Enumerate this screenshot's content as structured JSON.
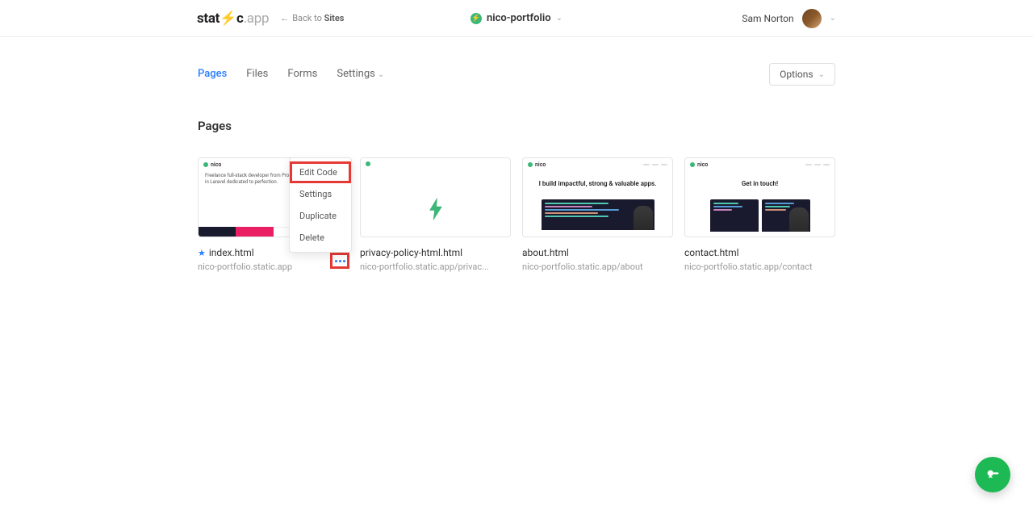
{
  "header": {
    "logo_prefix": "stat",
    "logo_bolt": "i",
    "logo_suffix": "c",
    "logo_ext": ".app",
    "back_arrow": "←",
    "back_text": "Back to ",
    "back_target": "Sites",
    "site_name": "nico-portfolio",
    "user_name": "Sam Norton"
  },
  "tabs": {
    "pages": "Pages",
    "files": "Files",
    "forms": "Forms",
    "settings": "Settings",
    "options": "Options"
  },
  "section_title": "Pages",
  "dropdown": {
    "edit_code": "Edit Code",
    "settings": "Settings",
    "duplicate": "Duplicate",
    "delete": "Delete"
  },
  "pages": [
    {
      "name": "index.html",
      "url": "nico-portfolio.static.app",
      "starred": true,
      "thumb_brand": "nico",
      "thumb_text": "Freelance full-stack developer from Problem solver specialised in Laravel dedicated to perfection."
    },
    {
      "name": "privacy-policy-html.html",
      "url": "nico-portfolio.static.app/privac...",
      "thumb_brand": ""
    },
    {
      "name": "about.html",
      "url": "nico-portfolio.static.app/about",
      "thumb_brand": "nico",
      "thumb_heading": "I build impactful, strong & valuable apps."
    },
    {
      "name": "contact.html",
      "url": "nico-portfolio.static.app/contact",
      "thumb_brand": "nico",
      "thumb_heading": "Get in touch!"
    }
  ]
}
